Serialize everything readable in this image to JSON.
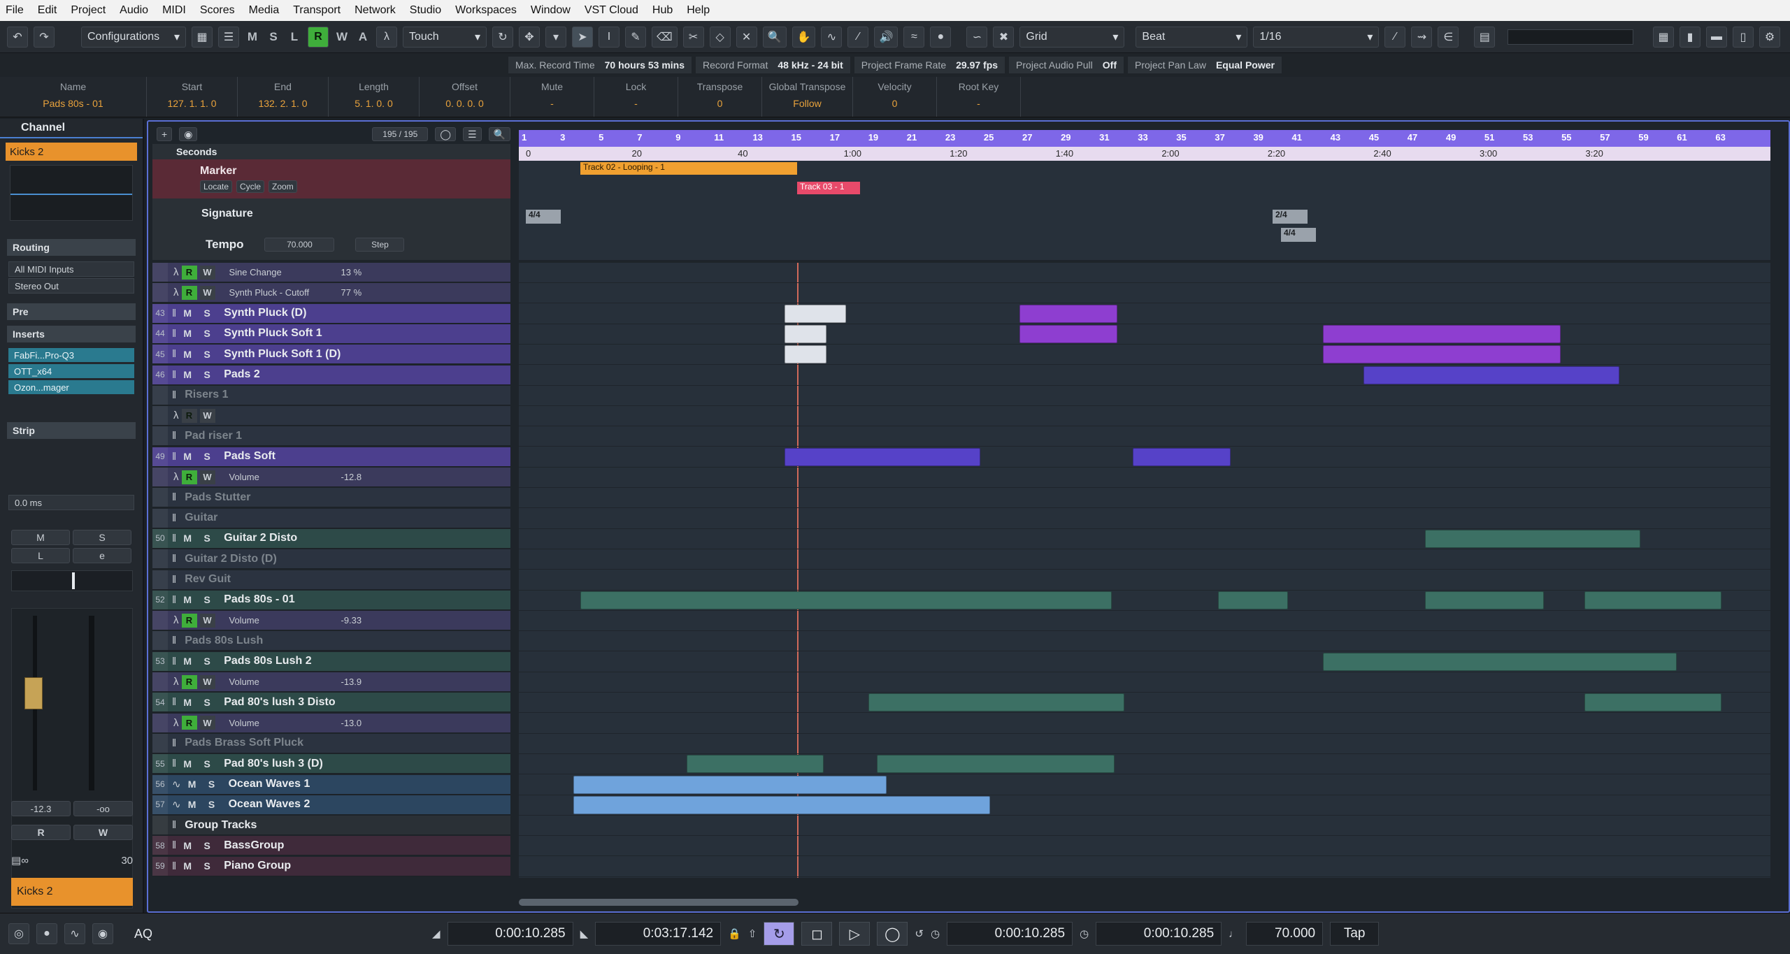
{
  "menu": [
    "File",
    "Edit",
    "Project",
    "Audio",
    "MIDI",
    "Scores",
    "Media",
    "Transport",
    "Network",
    "Studio",
    "Workspaces",
    "Window",
    "VST Cloud",
    "Hub",
    "Help"
  ],
  "toolbar": {
    "configurations": "Configurations",
    "mode_letters": [
      "M",
      "S",
      "L",
      "R",
      "W",
      "A"
    ],
    "automation_mode": "Touch",
    "snap": "Grid",
    "snap_type": "Beat",
    "quantize": "1/16"
  },
  "status": [
    {
      "label": "Max. Record Time",
      "value": "70 hours 53 mins"
    },
    {
      "label": "Record Format",
      "value": "48 kHz - 24 bit"
    },
    {
      "label": "Project Frame Rate",
      "value": "29.97 fps"
    },
    {
      "label": "Project Audio Pull",
      "value": "Off"
    },
    {
      "label": "Project Pan Law",
      "value": "Equal Power"
    }
  ],
  "info": [
    {
      "label": "Name",
      "value": "Pads 80s - 01"
    },
    {
      "label": "Start",
      "value": "127. 1. 1.   0"
    },
    {
      "label": "End",
      "value": "132. 2. 1.   0"
    },
    {
      "label": "Length",
      "value": "5. 1. 0.   0"
    },
    {
      "label": "Offset",
      "value": "0. 0. 0.   0"
    },
    {
      "label": "Mute",
      "value": "-"
    },
    {
      "label": "Lock",
      "value": "-"
    },
    {
      "label": "Transpose",
      "value": "0"
    },
    {
      "label": "Global Transpose",
      "value": "Follow"
    },
    {
      "label": "Velocity",
      "value": "0"
    },
    {
      "label": "Root Key",
      "value": "-"
    }
  ],
  "inspector": {
    "tab": "Channel",
    "track": "Kicks 2",
    "routing": "Routing",
    "input": "All MIDI Inputs",
    "output": "Stereo Out",
    "pre": "Pre",
    "inserts": "Inserts",
    "insert_slots": [
      "FabFi...Pro-Q3",
      "OTT_x64",
      "Ozon...mager"
    ],
    "strip": "Strip",
    "delay": "0.0 ms",
    "m": "M",
    "s": "S",
    "l": "L",
    "fader_val": "-12.3",
    "peak": "-oo",
    "r": "R",
    "w": "W",
    "bottom_name": "Kicks 2",
    "bottom_num": "30"
  },
  "counter": "195 / 195",
  "ruler_bars": [
    "1",
    "3",
    "5",
    "7",
    "9",
    "11",
    "13",
    "15",
    "17",
    "19",
    "21",
    "23",
    "25",
    "27",
    "29",
    "31",
    "33",
    "35",
    "37",
    "39",
    "41",
    "43",
    "45",
    "47",
    "49",
    "51",
    "53",
    "55",
    "57",
    "59",
    "61",
    "63"
  ],
  "ruler_times": [
    "0",
    "20",
    "40",
    "1:00",
    "1:20",
    "1:40",
    "2:00",
    "2:20",
    "2:40",
    "3:00",
    "3:20"
  ],
  "seconds_label": "Seconds",
  "marker": {
    "name": "Marker",
    "locate": "Locate",
    "cycle": "Cycle",
    "zoom": "Zoom",
    "marker1": "Track 02 - Looping -  1",
    "marker2": "Track 03 -  1"
  },
  "signature": {
    "name": "Signature",
    "sig1": "4/4",
    "sig2": "2/4",
    "sig3": "4/4"
  },
  "tempo": {
    "name": "Tempo",
    "value": "70.000",
    "mode": "Step"
  },
  "tracks": [
    {
      "n": "",
      "name": "",
      "type": "auto",
      "param": "Sine Change",
      "val": "13 %",
      "rw": true
    },
    {
      "n": "",
      "name": "",
      "type": "auto",
      "param": "Synth Pluck - Cutoff",
      "val": "77 %",
      "rw": true
    },
    {
      "n": "43",
      "name": "Synth Pluck (D)",
      "type": "inst"
    },
    {
      "n": "44",
      "name": "Synth Pluck Soft 1",
      "type": "inst"
    },
    {
      "n": "45",
      "name": "Synth Pluck Soft 1 (D)",
      "type": "inst"
    },
    {
      "n": "46",
      "name": "Pads 2",
      "type": "inst"
    },
    {
      "n": "",
      "name": "Risers 1",
      "type": "audio-dim"
    },
    {
      "n": "",
      "name": "",
      "type": "auto-dim",
      "param": "",
      "val": ""
    },
    {
      "n": "",
      "name": "Pad riser 1",
      "type": "audio-dim"
    },
    {
      "n": "49",
      "name": "Pads Soft",
      "type": "inst"
    },
    {
      "n": "",
      "name": "",
      "type": "auto",
      "param": "Volume",
      "val": "-12.8",
      "rw": true
    },
    {
      "n": "",
      "name": "Pads Stutter",
      "type": "folder-dim"
    },
    {
      "n": "",
      "name": "Guitar",
      "type": "folder-dim"
    },
    {
      "n": "50",
      "name": "Guitar 2 Disto",
      "type": "inst"
    },
    {
      "n": "",
      "name": "Guitar 2 Disto (D)",
      "type": "folder-dim"
    },
    {
      "n": "",
      "name": "Rev Guit",
      "type": "audio-dim"
    },
    {
      "n": "52",
      "name": "Pads 80s - 01",
      "type": "inst"
    },
    {
      "n": "",
      "name": "",
      "type": "auto",
      "param": "Volume",
      "val": "-9.33",
      "rw": true
    },
    {
      "n": "",
      "name": "Pads 80s Lush",
      "type": "folder-dim"
    },
    {
      "n": "53",
      "name": "Pads 80s Lush 2",
      "type": "inst"
    },
    {
      "n": "",
      "name": "",
      "type": "auto",
      "param": "Volume",
      "val": "-13.9",
      "rw": true
    },
    {
      "n": "54",
      "name": "Pad 80's lush 3 Disto",
      "type": "inst"
    },
    {
      "n": "",
      "name": "",
      "type": "auto",
      "param": "Volume",
      "val": "-13.0",
      "rw": true
    },
    {
      "n": "",
      "name": "Pads Brass Soft Pluck",
      "type": "folder-dim"
    },
    {
      "n": "55",
      "name": "Pad 80's lush 3 (D)",
      "type": "inst"
    },
    {
      "n": "56",
      "name": "Ocean Waves 1",
      "type": "audio"
    },
    {
      "n": "57",
      "name": "Ocean Waves 2",
      "type": "audio"
    },
    {
      "n": "",
      "name": "Group Tracks",
      "type": "group-folder"
    },
    {
      "n": "58",
      "name": "BassGroup",
      "type": "group"
    },
    {
      "n": "59",
      "name": "Piano Group",
      "type": "group"
    }
  ],
  "transport": {
    "left_locator": "0:00:10.285",
    "right_locator": "0:03:17.142",
    "primary": "0:00:10.285",
    "secondary": "0:00:10.285",
    "tempo": "70.000",
    "tap": "Tap",
    "aq": "AQ"
  },
  "colors": {
    "ruler": "#7e67e8",
    "marker_track": "#f0a030",
    "accent": "#5a6fd4",
    "record": "#e8922c"
  }
}
